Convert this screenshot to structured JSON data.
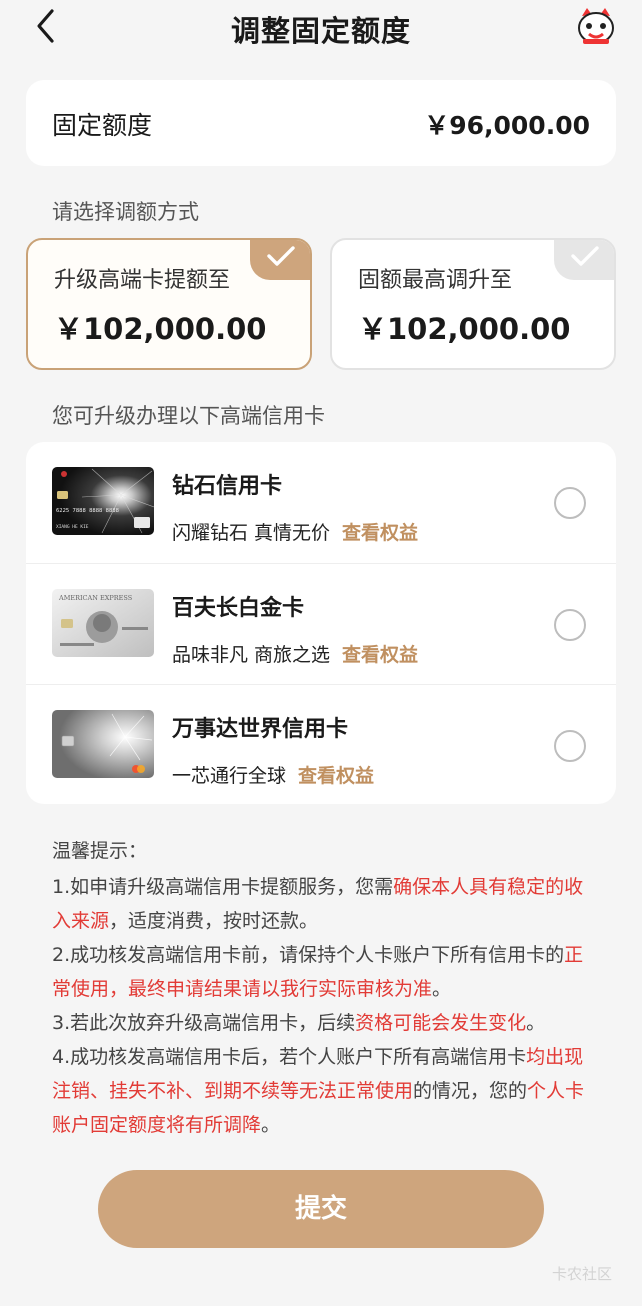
{
  "header": {
    "title": "调整固定额度"
  },
  "quota": {
    "label": "固定额度",
    "value": "￥96,000.00"
  },
  "method": {
    "section_label": "请选择调额方式",
    "options": [
      {
        "title": "升级高端卡提额至",
        "amount": "￥102,000.00",
        "selected": true
      },
      {
        "title": "固额最高调升至",
        "amount": "￥102,000.00",
        "selected": false
      }
    ]
  },
  "cards": {
    "section_label": "您可升级办理以下高端信用卡",
    "items": [
      {
        "name": "钻石信用卡",
        "slogan": "闪耀钻石 真情无价",
        "link": "查看权益",
        "thumb_text": "6225 7888 8888 8888",
        "thumb_holder": "XIANG HE KIE"
      },
      {
        "name": "百夫长白金卡",
        "slogan": "品味非凡 商旅之选",
        "link": "查看权益",
        "thumb_text": "AMERICAN EXPRESS"
      },
      {
        "name": "万事达世界信用卡",
        "slogan": "一芯通行全球",
        "link": "查看权益"
      }
    ]
  },
  "tips": {
    "title": "温馨提示：",
    "items": [
      [
        {
          "t": "1.如申请升级高端信用卡提额服务，您需"
        },
        {
          "t": "确保本人具有稳定的收入来源",
          "red": true
        },
        {
          "t": "，适度消费，按时还款。"
        }
      ],
      [
        {
          "t": "2.成功核发高端信用卡前，请保持个人卡账户下所有信用卡的"
        },
        {
          "t": "正常使用",
          "red": true
        },
        {
          "t": "，"
        },
        {
          "t": "最终申请结果请以我行实际审核为准",
          "red": true
        },
        {
          "t": "。"
        }
      ],
      [
        {
          "t": "3.若此次放弃升级高端信用卡，后续"
        },
        {
          "t": "资格可能会发生变化",
          "red": true
        },
        {
          "t": "。"
        }
      ],
      [
        {
          "t": "4.成功核发高端信用卡后，若个人账户下所有高端信用卡"
        },
        {
          "t": "均出现注销、挂失不补、到期不续等无法正常使用",
          "red": true
        },
        {
          "t": "的情况，您的"
        },
        {
          "t": "个人卡账户固定额度将有所调降",
          "red": true
        },
        {
          "t": "。"
        }
      ]
    ]
  },
  "submit_label": "提交",
  "watermark": "卡农社区",
  "colors": {
    "accent": "#cea57d",
    "link": "#c09060",
    "warning": "#e23b36"
  },
  "icons": {
    "back": "chevron-left-icon",
    "mascot": "mascot-icon",
    "check": "check-icon"
  }
}
